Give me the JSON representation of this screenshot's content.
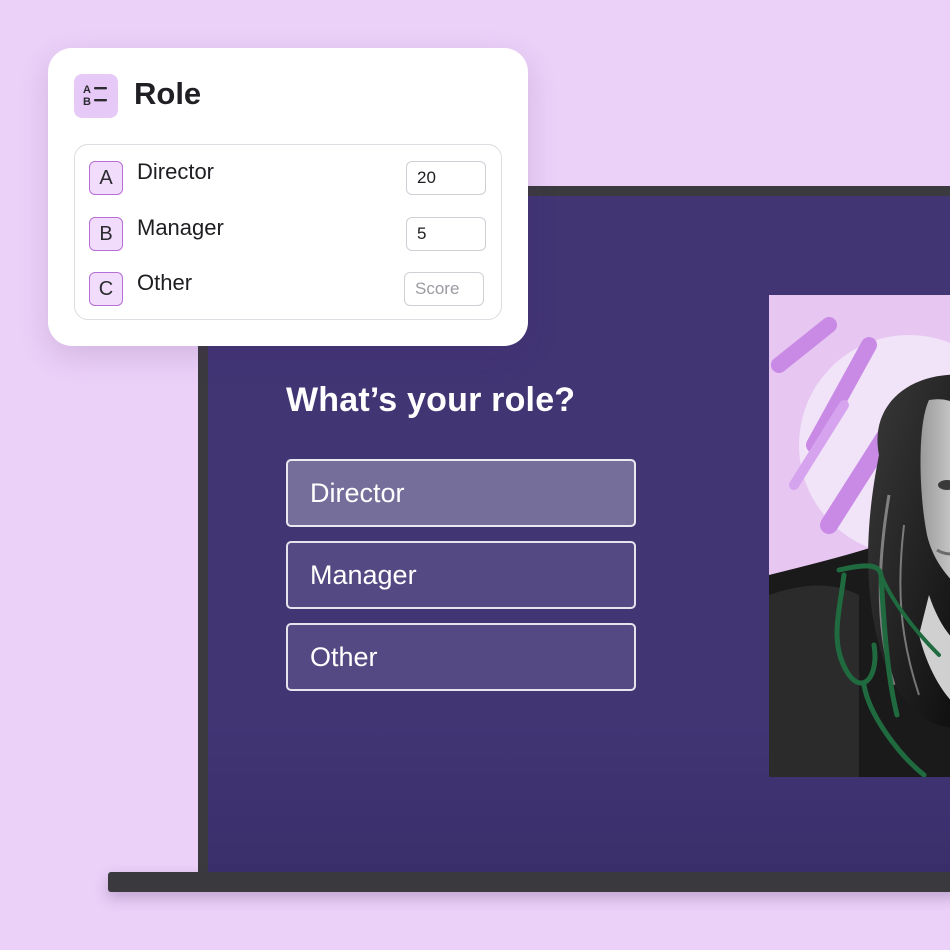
{
  "role_card": {
    "icon": "multiple-choice-icon",
    "title": "Role",
    "choices": [
      {
        "letter": "A",
        "label": "Director",
        "score": "20",
        "placeholder": "Score"
      },
      {
        "letter": "B",
        "label": "Manager",
        "score": "5",
        "placeholder": "Score"
      },
      {
        "letter": "C",
        "label": "Other",
        "score": "",
        "placeholder": "Score"
      }
    ]
  },
  "slide": {
    "question": "What’s your role?",
    "options": [
      {
        "label": "Director",
        "selected": true
      },
      {
        "label": "Manager",
        "selected": false
      },
      {
        "label": "Other",
        "selected": false
      }
    ],
    "image": "woman-portrait-photo"
  },
  "colors": {
    "page_background": "#ebd1f8",
    "slide_background": "#413574",
    "accent_lilac": "#e7c9f7",
    "accent_border": "#b56fd6",
    "sketch_green": "#1f6b3f"
  }
}
